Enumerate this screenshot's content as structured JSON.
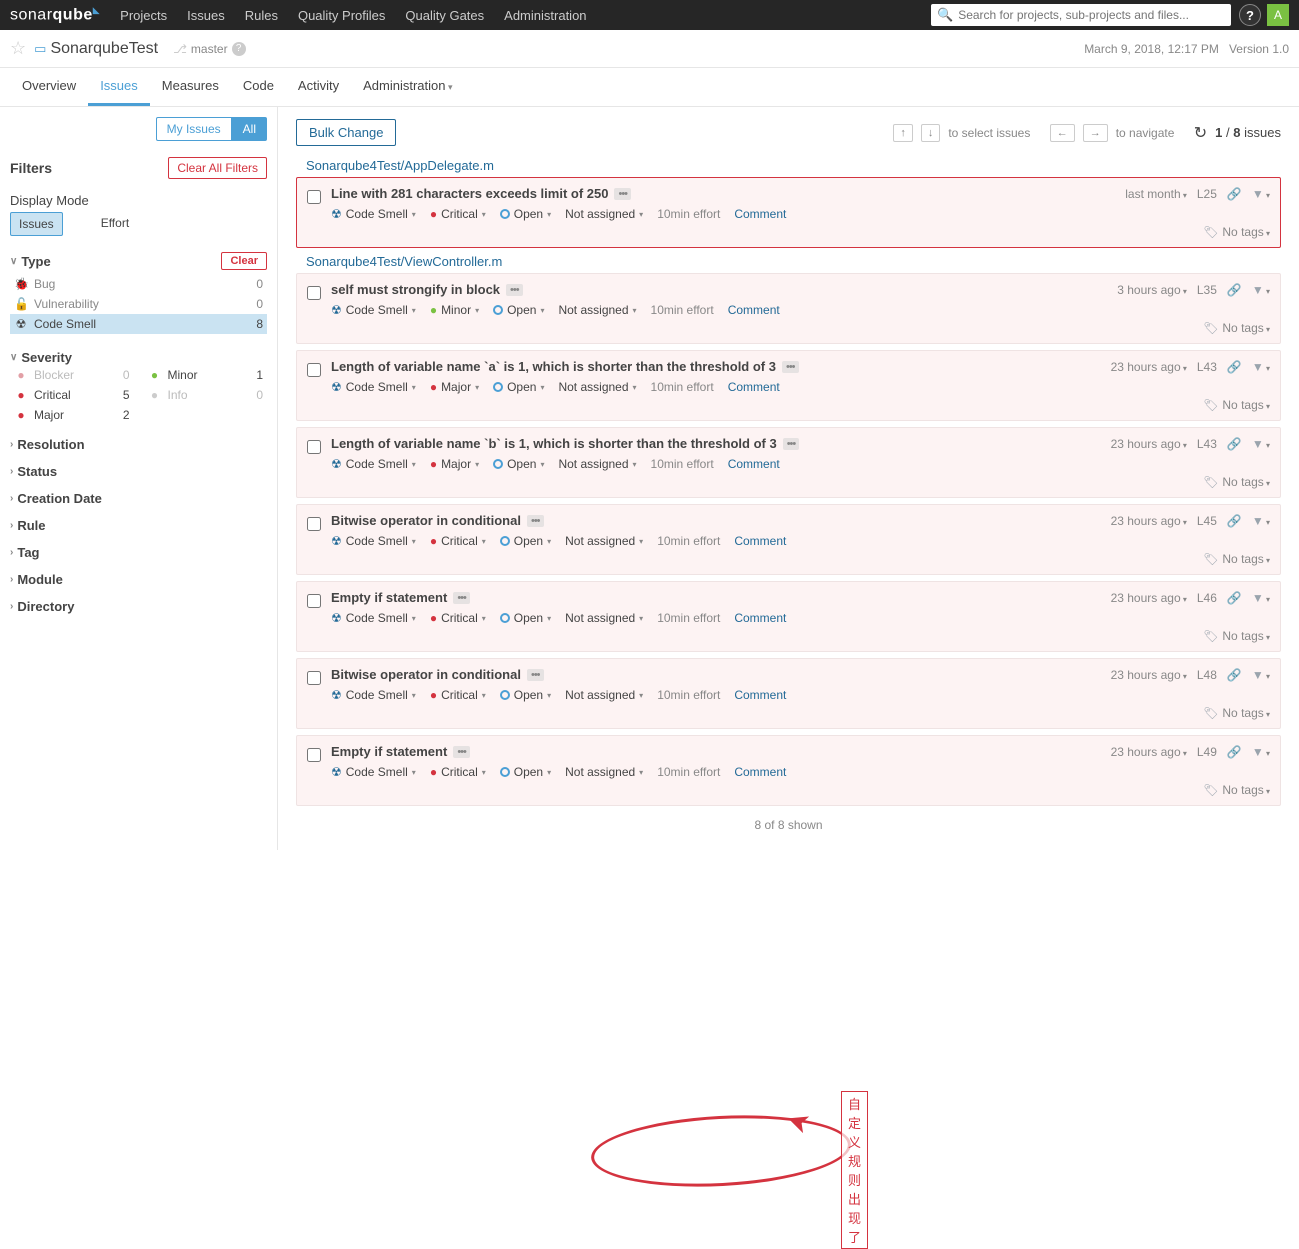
{
  "topnav": {
    "logo_a": "sonar",
    "logo_b": "qube",
    "links": [
      "Projects",
      "Issues",
      "Rules",
      "Quality Profiles",
      "Quality Gates",
      "Administration"
    ],
    "search_placeholder": "Search for projects, sub-projects and files...",
    "avatar": "A"
  },
  "project": {
    "name": "SonarqubeTest",
    "branch": "master",
    "date": "March 9, 2018, 12:17 PM",
    "version": "Version 1.0"
  },
  "subnav": [
    "Overview",
    "Issues",
    "Measures",
    "Code",
    "Activity",
    "Administration"
  ],
  "subnav_active": 1,
  "sidebar": {
    "my_issues": "My Issues",
    "all": "All",
    "filters": "Filters",
    "clear_all": "Clear All Filters",
    "display_mode": "Display Mode",
    "dm_issues": "Issues",
    "dm_effort": "Effort",
    "clear": "Clear",
    "type": {
      "label": "Type",
      "items": [
        {
          "ic": "🐞",
          "label": "Bug",
          "count": "0"
        },
        {
          "ic": "🔓",
          "label": "Vulnerability",
          "count": "0"
        },
        {
          "ic": "☢",
          "label": "Code Smell",
          "count": "8",
          "active": true
        }
      ]
    },
    "severity": {
      "label": "Severity",
      "left": [
        {
          "cls": "",
          "label": "Blocker",
          "count": "0",
          "color": "#e2a0a6"
        },
        {
          "cls": "",
          "label": "Critical",
          "count": "5",
          "color": "#d4333f"
        },
        {
          "cls": "",
          "label": "Major",
          "count": "2",
          "color": "#d4333f"
        }
      ],
      "right": [
        {
          "cls": "",
          "label": "Minor",
          "count": "1",
          "color": "#7ac142"
        },
        {
          "cls": "",
          "label": "Info",
          "count": "0",
          "color": "#ccc"
        }
      ]
    },
    "facets": [
      "Resolution",
      "Status",
      "Creation Date",
      "Rule",
      "Tag",
      "Module",
      "Directory"
    ]
  },
  "content": {
    "bulk": "Bulk Change",
    "select_hint": "to select issues",
    "nav_hint": "to navigate",
    "page_cur": "1",
    "page_sep": "/",
    "page_total": "8",
    "page_word": "issues",
    "no_tags": "No tags",
    "comment": "Comment",
    "type_label": "Code Smell",
    "status_label": "Open",
    "assign_label": "Not assigned",
    "files": [
      {
        "path": "Sonarqube4Test/AppDelegate.m",
        "issues": [
          {
            "title": "Line with 281 characters exceeds limit of 250",
            "sev": "Critical",
            "sevcls": "sev-critical",
            "age": "last month",
            "line": "L25",
            "effort": "10min effort",
            "sel": true
          }
        ]
      },
      {
        "path": "Sonarqube4Test/ViewController.m",
        "issues": [
          {
            "title": "self must strongify in block",
            "sev": "Minor",
            "sevcls": "sev-minor",
            "age": "3 hours ago",
            "line": "L35",
            "effort": "10min effort"
          },
          {
            "title": "Length of variable name `a` is 1, which is shorter than the threshold of 3",
            "sev": "Major",
            "sevcls": "sev-major",
            "age": "23 hours ago",
            "line": "L43",
            "effort": "10min effort"
          },
          {
            "title": "Length of variable name `b` is 1, which is shorter than the threshold of 3",
            "sev": "Major",
            "sevcls": "sev-major",
            "age": "23 hours ago",
            "line": "L43",
            "effort": "10min effort"
          },
          {
            "title": "Bitwise operator in conditional",
            "sev": "Critical",
            "sevcls": "sev-critical",
            "age": "23 hours ago",
            "line": "L45",
            "effort": "10min effort"
          },
          {
            "title": "Empty if statement",
            "sev": "Critical",
            "sevcls": "sev-critical",
            "age": "23 hours ago",
            "line": "L46",
            "effort": "10min effort"
          },
          {
            "title": "Bitwise operator in conditional",
            "sev": "Critical",
            "sevcls": "sev-critical",
            "age": "23 hours ago",
            "line": "L48",
            "effort": "10min effort"
          },
          {
            "title": "Empty if statement",
            "sev": "Critical",
            "sevcls": "sev-critical",
            "age": "23 hours ago",
            "line": "L49",
            "effort": "10min effort"
          }
        ]
      }
    ],
    "shown": "8 of 8 shown"
  },
  "annotation": "自定义规则出现了"
}
